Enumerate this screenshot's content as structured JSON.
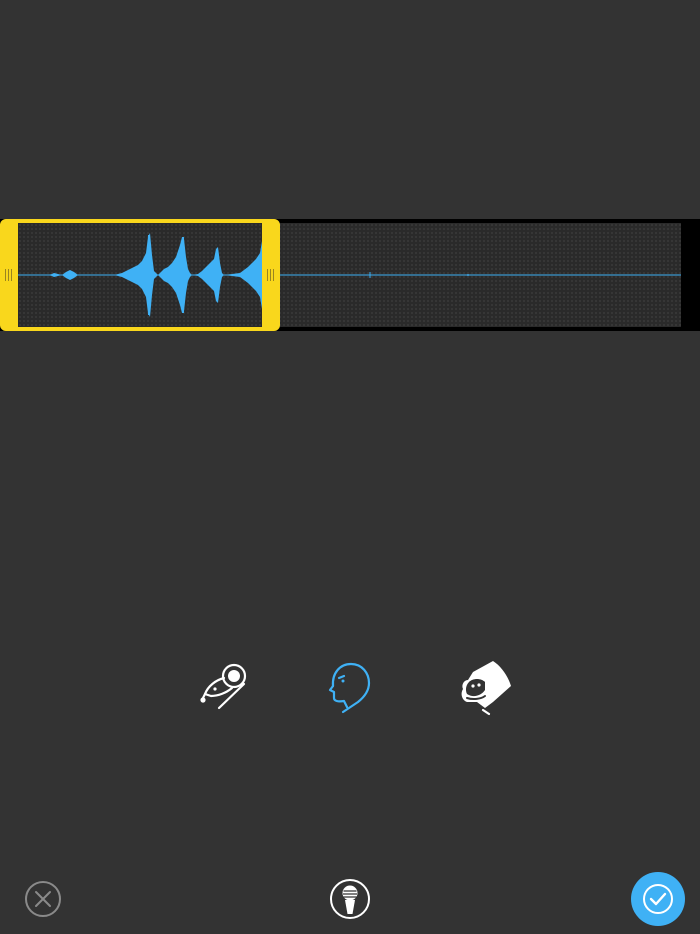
{
  "waveform": {
    "selection_start": 0.0,
    "selection_end": 0.39,
    "colors": {
      "wave": "#3fb1f5",
      "selection_border": "#f9d71c",
      "background": "#333333",
      "track": "#000000"
    }
  },
  "voices": [
    {
      "icon": "mouse-icon",
      "selected": false
    },
    {
      "icon": "human-head-icon",
      "selected": true
    },
    {
      "icon": "gorilla-icon",
      "selected": false
    }
  ],
  "toolbar": {
    "cancel_icon": "close-circle-icon",
    "record_icon": "microphone-icon",
    "confirm_icon": "checkmark-icon",
    "accent_color": "#3fb1f5"
  }
}
